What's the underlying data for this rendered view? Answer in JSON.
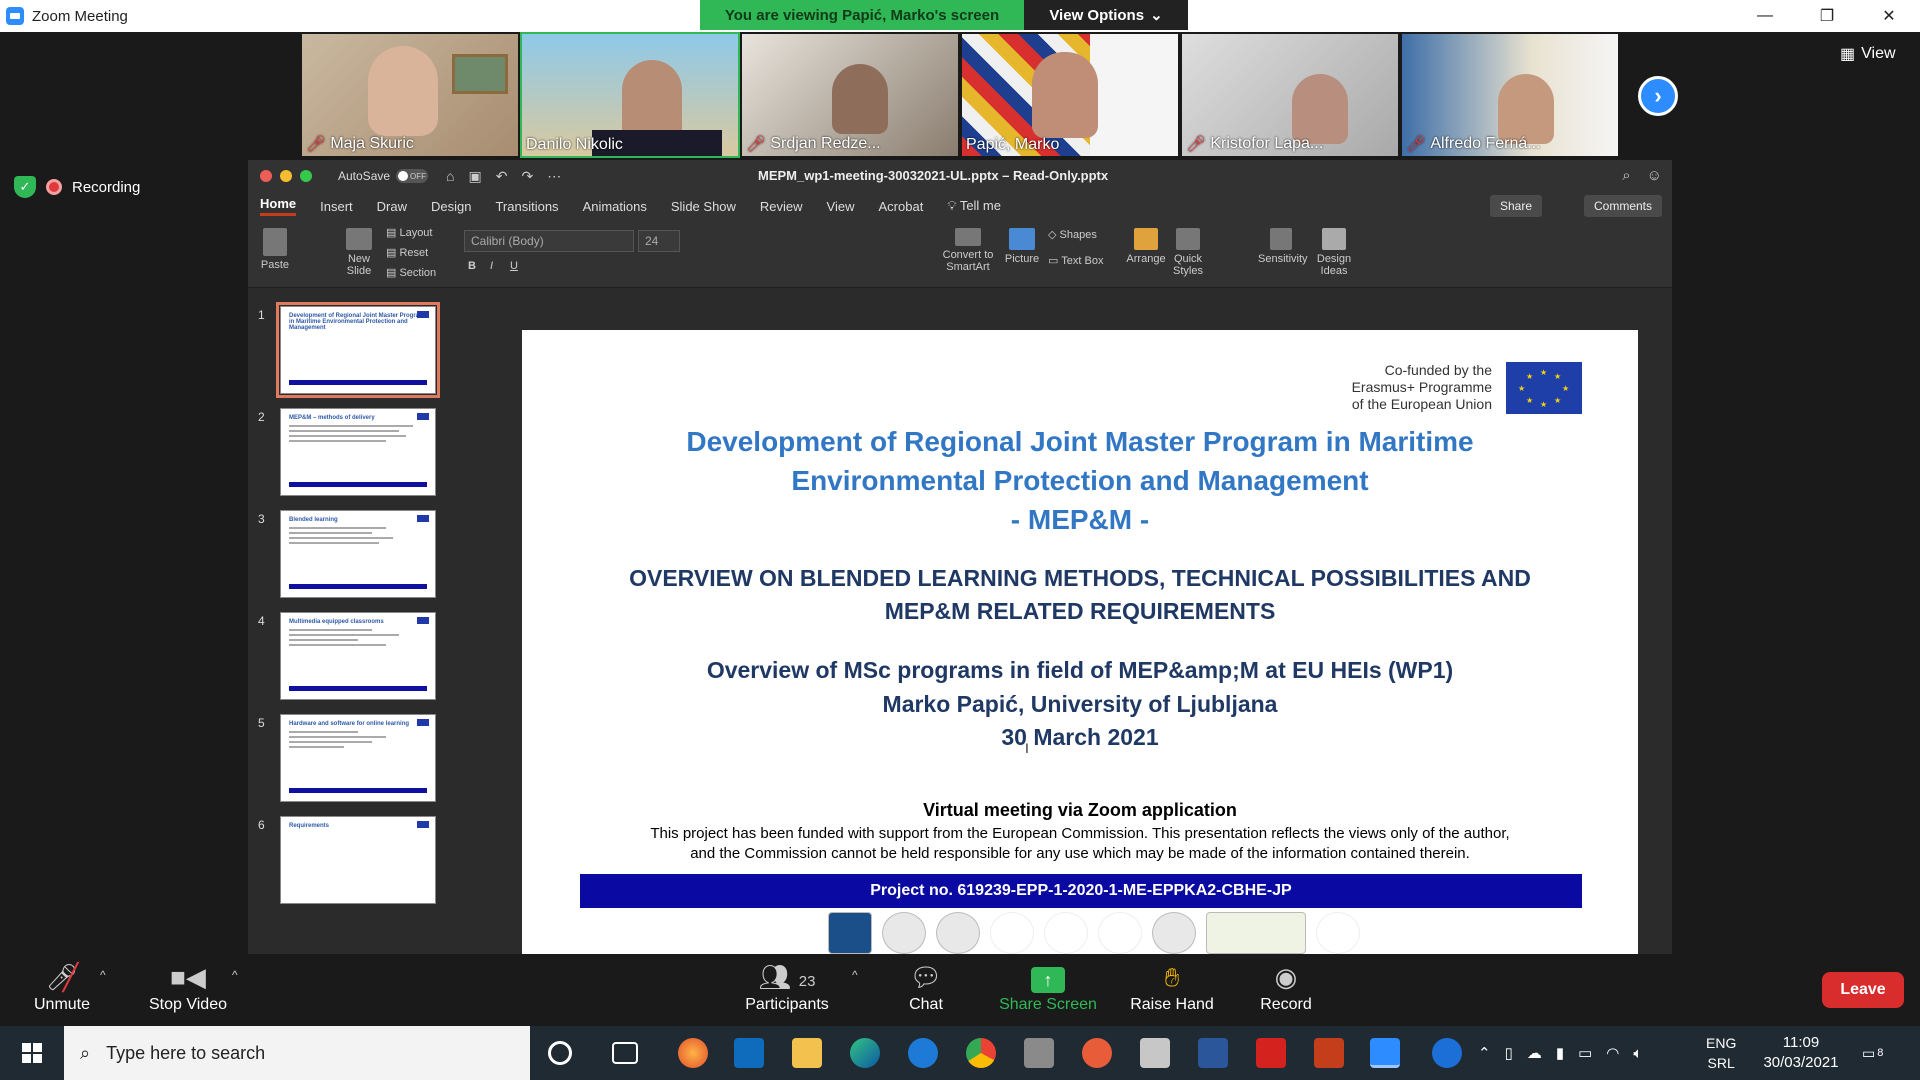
{
  "window": {
    "title": "Zoom Meeting"
  },
  "banner": {
    "viewing": "You are viewing Papić, Marko's screen",
    "view_options": "View Options"
  },
  "gallery": {
    "participants": [
      {
        "name": "Maja Skuric",
        "muted": true
      },
      {
        "name": "Danilo Nikolic",
        "muted": false
      },
      {
        "name": "Srdjan Redze...",
        "muted": true
      },
      {
        "name": "Papić, Marko",
        "muted": false
      },
      {
        "name": "Kristofor Lapa...",
        "muted": true
      },
      {
        "name": "Alfredo Ferná...",
        "muted": true
      }
    ],
    "view_label": "View"
  },
  "recording": {
    "label": "Recording"
  },
  "ppt": {
    "autosave": "AutoSave",
    "autosave_state": "OFF",
    "doc_title": "MEPM_wp1-meeting-30032021-UL.pptx  –  Read-Only.pptx",
    "tabs": [
      "Home",
      "Insert",
      "Draw",
      "Design",
      "Transitions",
      "Animations",
      "Slide Show",
      "Review",
      "View",
      "Acrobat",
      "Tell me"
    ],
    "share": "Share",
    "comments": "Comments",
    "ribbon": {
      "paste": "Paste",
      "new_slide": "New Slide",
      "layout": "Layout",
      "reset": "Reset",
      "section": "Section",
      "font": "Calibri (Body)",
      "size": "24",
      "convert": "Convert to SmartArt",
      "picture": "Picture",
      "shapes": "Shapes",
      "text_box": "Text Box",
      "arrange": "Arrange",
      "quick_styles": "Quick Styles",
      "sensitivity": "Sensitivity",
      "design_ideas": "Design Ideas"
    },
    "thumbnails": [
      {
        "num": "1",
        "title": "Development of Regional Joint Master Program in Maritime Environmental Protection and Management"
      },
      {
        "num": "2",
        "title": "MEP&M – methods of delivery"
      },
      {
        "num": "3",
        "title": "Blended learning"
      },
      {
        "num": "4",
        "title": "Multimedia equipped classrooms"
      },
      {
        "num": "5",
        "title": "Hardware and software for online learning"
      },
      {
        "num": "6",
        "title": "Requirements"
      }
    ],
    "slide": {
      "eu_line1": "Co-funded by the",
      "eu_line2": "Erasmus+ Programme",
      "eu_line3": "of the European Union",
      "title1": "Development of Regional Joint Master Program in Maritime",
      "title2": "Environmental Protection and Management",
      "title3": "- MEP&M -",
      "sub1": "OVERVIEW ON BLENDED LEARNING METHODS, TECHNICAL POSSIBILITIES AND",
      "sub2": "MEP&M RELATED REQUIREMENTS",
      "sub3": "Overview of MSc programs in field of MEP&amp;M at EU HEIs (WP1)",
      "sub4": "Marko Papić, University of Ljubljana",
      "sub5": "30 March 2021",
      "meeting": "Virtual meeting via Zoom application",
      "disc1": "This project has been funded with support from the European Commission. This presentation reflects the views only of the author,",
      "disc2": "and the Commission cannot be held responsible for any use which may be made of the information contained therein.",
      "project": "Project no. 619239-EPP-1-2020-1-ME-EPPKA2-CBHE-JP"
    }
  },
  "controls": {
    "unmute": "Unmute",
    "stop_video": "Stop Video",
    "participants": "Participants",
    "participants_count": "23",
    "chat": "Chat",
    "share_screen": "Share Screen",
    "raise_hand": "Raise Hand",
    "record": "Record",
    "leave": "Leave"
  },
  "taskbar": {
    "search_placeholder": "Type here to search",
    "lang1": "ENG",
    "lang2": "SRL",
    "time": "11:09",
    "date": "30/03/2021",
    "notifications": "8"
  }
}
